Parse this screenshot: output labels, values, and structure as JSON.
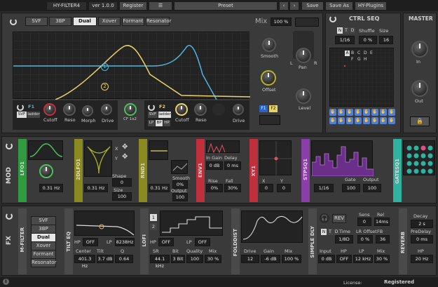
{
  "topbar": {
    "logo": "HY-FILTER4",
    "version": "ver 1.0.0",
    "register": "Register",
    "menu_icon": "hamburger-icon",
    "preset": "Preset",
    "save": "Save",
    "save_as": "Save As",
    "plugins": "HY-Plugins"
  },
  "filter": {
    "modes": [
      "SVF",
      "3BP",
      "Dual",
      "Xover",
      "Formant",
      "Resonator"
    ],
    "selected_mode": "Dual",
    "mix_label": "Mix",
    "mix_value": "100 %",
    "marker1": "1",
    "marker2": "2",
    "smooth": "Smooth",
    "pan": "Pan",
    "pan_l": "L",
    "pan_r": "R",
    "offset": "Offset",
    "level": "Level",
    "f1": {
      "name": "F1",
      "type_svf": "SVF",
      "type_ladder": "ladder",
      "cutoff": "Cutoff",
      "reso": "Reso",
      "morph": "Morph",
      "drive": "Drive"
    },
    "cf": "CF 1x2",
    "f2": {
      "name": "F2",
      "type_svf": "SVF",
      "type_ladder": "ladder",
      "lp": "LP",
      "bp": "BP",
      "hp": "HP",
      "cutoff": "Cutoff",
      "reso": "Reso",
      "drive": "Drive"
    },
    "routing_f1": "F1",
    "routing_f2": "F2"
  },
  "ctrl_seq": {
    "title": "CTRL SEQ",
    "n": "N",
    "t": "T",
    "d": "D",
    "shuffle": "Shuffle",
    "size": "Size",
    "rate": "1/16",
    "shuffle_value": "0 %",
    "size_value": "16",
    "letters": [
      "A",
      "B",
      "C",
      "D",
      "E",
      "F",
      "G",
      "H"
    ]
  },
  "master": {
    "title": "MASTER",
    "in": "In",
    "out": "Out"
  },
  "mod": {
    "section": "MOD",
    "lfo1": {
      "name": "LFO1",
      "rate": "0.31 Hz"
    },
    "zdfo1": {
      "name": "2DLFO1",
      "rate": "0.31 Hz",
      "x": "X",
      "y": "Y",
      "shape": "Shape",
      "shape_value": "0",
      "size": "Size",
      "size_value": "100"
    },
    "rnd1": {
      "name": "RND1",
      "rate": "0.31 Hz",
      "smooth": "Smooth",
      "smooth_value": "0%",
      "output": "Output",
      "output_value": "100"
    },
    "env1": {
      "name": "ENV1",
      "in_gain": "In Gain",
      "delay": "Delay",
      "in_gain_value": "0 dB",
      "delay_value": "0 ms",
      "rise": "Rise",
      "fall": "Fall",
      "rise_value": "0%",
      "fall_value": "30%"
    },
    "xy1": {
      "name": "XY1",
      "x": "X",
      "y": "Y",
      "x_value": "0",
      "y_value": "0"
    },
    "stpsq1": {
      "name": "STPSQ1",
      "rate": "1/16",
      "gate": "Gate",
      "gate_value": "100",
      "output": "Output",
      "output_value": "100"
    },
    "gatesq1": {
      "name": "GATESQ1"
    }
  },
  "fx": {
    "section": "FX",
    "mfilter": {
      "name": "M-FILTER",
      "modes": [
        "SVF",
        "3BP",
        "Dual",
        "Xover",
        "Formant",
        "Resonator"
      ],
      "selected": "Dual"
    },
    "tilteq": {
      "name": "TILT EQ",
      "hp": "HP",
      "hp_value": "OFF",
      "lp": "LP",
      "lp_value": "8238Hz",
      "center": "Center",
      "tilt": "Tilt",
      "q": "Q",
      "center_value": "401.3 Hz",
      "tilt_value": "3.7 dB",
      "q_value": "0.64"
    },
    "lofi": {
      "name": "LOFI",
      "hp": "HP",
      "hp_value": "OFF",
      "lp": "LP",
      "lp_value": "OFF",
      "sr": "SR",
      "bit": "Bit",
      "quality": "Quality",
      "mix": "Mix",
      "sr_value": "44.1 kHz",
      "bit_value": "3 Bit",
      "quality_value": "100",
      "mix_value": "30 %",
      "tab1": "1",
      "tab2": "2"
    },
    "foldist": {
      "name": "FOLDDIST",
      "drive": "Drive",
      "gain": "Gain",
      "mix": "Mix",
      "drive_value": "12",
      "gain_value": "-6 dB",
      "mix_value": "100 %"
    },
    "simpledly": {
      "name": "SIMPLE DLY",
      "rev": "REV",
      "sens": "Sens",
      "sens_value": "0",
      "rel": "Rel",
      "rel_value": "14ms",
      "n": "N",
      "t": "T",
      "d": "D",
      "time": "Time",
      "time_value": "1/8D",
      "lr_offset": "LR Offset",
      "lr_value": "0 %",
      "fb": "FB",
      "fb_value": "36",
      "input": "Input",
      "hp": "HP",
      "lp": "LP",
      "mix": "Mix",
      "input_value": "0 dB",
      "hp_value": "OFF",
      "lp_value": "12 kHz",
      "mix_value": "30 %"
    },
    "reverb": {
      "name": "REVERB",
      "decay": "Decay",
      "decay_value": "2 s",
      "predelay": "PreDelay",
      "predelay_value": "0 ms",
      "hp": "HP",
      "hp_value": "20 Hz"
    }
  },
  "status": {
    "license": "License:",
    "registered": "Registered"
  },
  "colors": {
    "cyan": "#4fb6e0",
    "yellow": "#e8d36a",
    "lfo_green": "#4cc05a",
    "olive": "#b4b42a",
    "env_red": "#c0303c",
    "purple": "#a04fc0",
    "teal": "#2fb3a0",
    "ctrl_blue": "#4f7fd8"
  }
}
